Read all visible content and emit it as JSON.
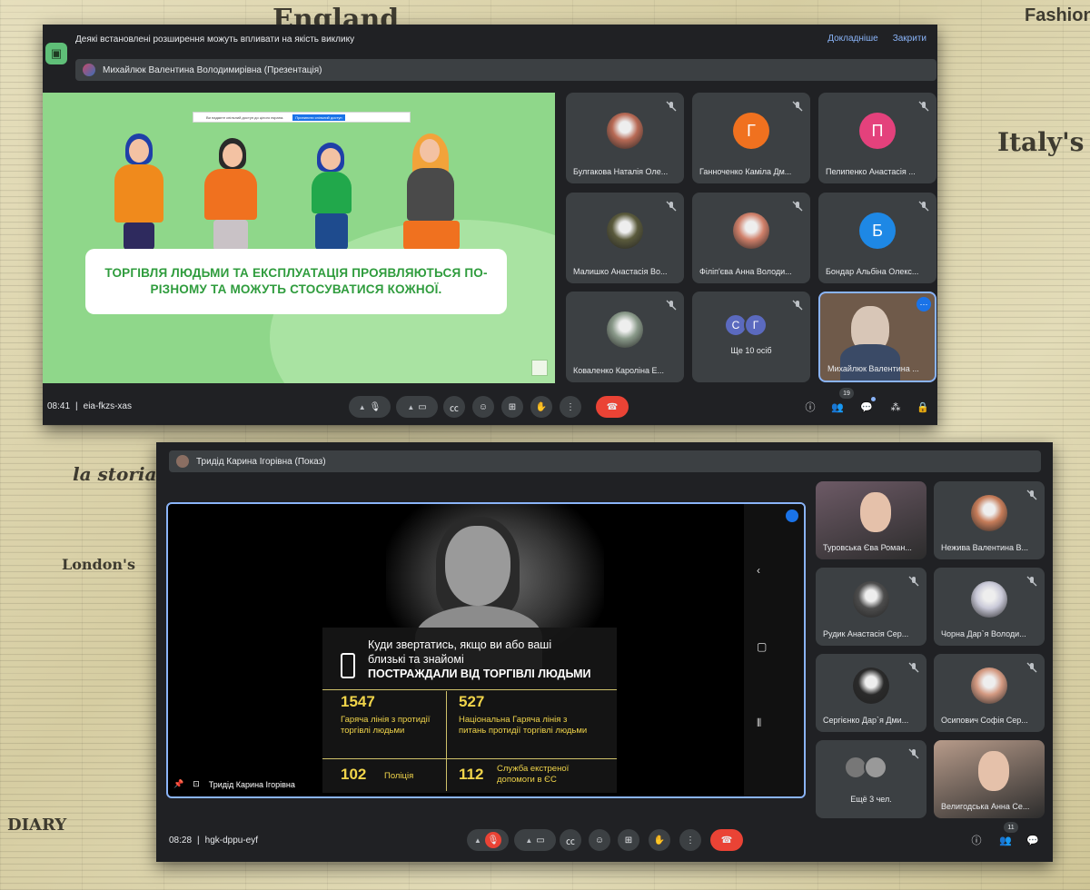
{
  "window1": {
    "banner_text": "Деякі встановлені розширення можуть впливати на якість виклику",
    "banner_details": "Докладніше",
    "banner_close": "Закрити",
    "presenter": "Михайлюк Валентина Володимирівна (Презентація)",
    "slide": {
      "share_note": "Ви надаєте спільний доступ до цілого екрана.",
      "share_button": "Припинити спільний доступ",
      "message": "ТОРГІВЛЯ ЛЮДЬМИ ТА ЕКСПЛУАТАЦІЯ ПРОЯВЛЯЮТЬСЯ ПО-РІЗНОМУ ТА МОЖУТЬ СТОСУВАТИСЯ КОЖНОЇ."
    },
    "tiles": [
      {
        "name": "Булгакова Наталія Оле...",
        "type": "photo",
        "color": "#b86a55"
      },
      {
        "name": "Ганноченко Каміла Дм...",
        "type": "letter",
        "letter": "Г",
        "color": "#f0711f"
      },
      {
        "name": "Пелипенко Анастасія ...",
        "type": "letter",
        "letter": "П",
        "color": "#e4417c"
      },
      {
        "name": "Малишко Анастасія Во...",
        "type": "photo",
        "color": "#5a5a3c"
      },
      {
        "name": "Філіп'єва Анна Володи...",
        "type": "photo",
        "color": "#d0806a"
      },
      {
        "name": "Бондар Альбіна Олекс...",
        "type": "letter",
        "letter": "Б",
        "color": "#1e88e5"
      },
      {
        "name": "Коваленко Кароліна Е...",
        "type": "photo",
        "color": "#8a9a8a"
      },
      {
        "name": "Ще 10 осіб",
        "type": "more",
        "letters": [
          "С",
          "Г"
        ]
      },
      {
        "name": "Михайлюк Валентина ...",
        "type": "self"
      }
    ],
    "time": "08:41",
    "code": "eia-fkzs-xas",
    "participants_count": "19",
    "icons": [
      "chevron-up-icon",
      "mic-icon",
      "chevron-up-icon",
      "camera-icon",
      "captions-icon",
      "emoji-icon",
      "present-icon",
      "hand-icon",
      "more-icon",
      "end-call-icon",
      "info-icon",
      "people-icon",
      "chat-icon",
      "activities-icon",
      "lock-icon"
    ]
  },
  "window2": {
    "presenter": "Тридід Карина Ігорівна (Показ)",
    "slide": {
      "line1": "Куди звертатись, якщо ви або ваші близькі та знайомі",
      "line2": "ПОСТРАЖДАЛИ ВІД ТОРГІВЛІ ЛЮДЬМИ",
      "n1": "1547",
      "d1": "Гаряча лінія з протидії торгівлі людьми",
      "n2": "527",
      "d2": "Національна Гаряча лінія з питань протидії торгівлі людьми",
      "n3": "102",
      "d3": "Поліція",
      "n4": "112",
      "d4": "Служба екстреної допомоги в ЄС"
    },
    "pinned_name": "Тридід Карина Ігорівна",
    "tiles": [
      {
        "name": "Туровська Єва Роман...",
        "type": "video",
        "color": "#6d5a66"
      },
      {
        "name": "Нежива Валентина В...",
        "type": "photo",
        "color": "#c77d5a"
      },
      {
        "name": "Рудик Анастасія Сер...",
        "type": "photo",
        "color": "#4d4d4d"
      },
      {
        "name": "Чорна Дар`я Володи...",
        "type": "photo",
        "color": "#c9c9d8"
      },
      {
        "name": "Сергієнко Дар`я Дми...",
        "type": "photo",
        "color": "#2a2a2a"
      },
      {
        "name": "Осипович Софія Сер...",
        "type": "photo",
        "color": "#d49a82"
      },
      {
        "name": "Ещё 3 чел.",
        "type": "more2"
      },
      {
        "name": "Велигодська Анна Се...",
        "type": "video",
        "color": "#b79b8a"
      }
    ],
    "time": "08:28",
    "code": "hgk-dppu-eyf",
    "participants_count": "11"
  },
  "colors": {
    "meet_bg": "#202124",
    "tile_bg": "#3c4043",
    "end_call": "#ea4335",
    "accent": "#8ab4f8",
    "slide_green": "#8fd78a",
    "slide_text_green": "#2f9c3d",
    "hotline_yellow": "#f0d44a"
  }
}
